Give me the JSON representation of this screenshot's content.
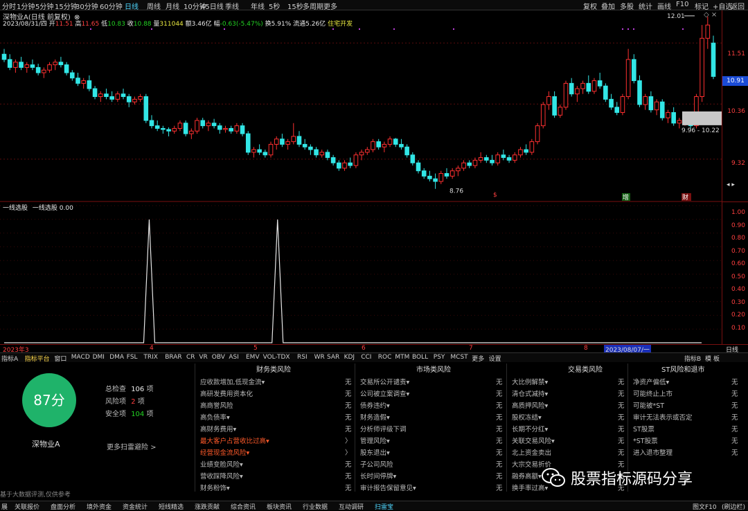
{
  "toolbar": {
    "timeframes": [
      "分时",
      "1分钟",
      "5分钟",
      "15分钟",
      "30分钟",
      "60分钟",
      "日线",
      "周线",
      "月线",
      "10分钟",
      "45日线",
      "季线",
      "年线",
      "5秒",
      "15秒",
      "多周期",
      "更多"
    ],
    "active_timeframe": "日线",
    "right_buttons": [
      "复权",
      "叠加",
      "多股",
      "统计",
      "画线",
      "F10",
      "标记",
      "+自选",
      "返回"
    ]
  },
  "stock": {
    "title": "深物业A(日线 前复权)",
    "date": "2023/08/31/四",
    "open_label": "开",
    "open": "11.51",
    "high_label": "高",
    "high": "11.65",
    "low_label": "低",
    "low": "10.83",
    "close_label": "收",
    "close": "10.88",
    "volume_label": "量",
    "volume": "311044",
    "amount_label": "额",
    "amount": "3.46亿",
    "change_label": "幅",
    "change": "-0.63(-5.47%)",
    "turnover_label": "换",
    "turnover": "5.91%",
    "float_label": "流通",
    "float_cap": "5.26亿",
    "concept": "住宅开发"
  },
  "price_axis": {
    "ticks": [
      "11.51",
      "10.36",
      "9.32"
    ],
    "current": "10.91"
  },
  "indicator": {
    "name": "一线选股",
    "line_label": "一线选股",
    "value": "0.00",
    "ticks": [
      "1.00",
      "0.90",
      "0.80",
      "0.70",
      "0.60",
      "0.50",
      "0.40",
      "0.30",
      "0.20",
      "0.10"
    ]
  },
  "annotations": {
    "high_label": "12.01",
    "low_label": "8.76",
    "range_label": "9.96 - 10.22",
    "marker_s": "$",
    "marker_zhu": "增",
    "marker_cai": "财"
  },
  "xaxis": {
    "labels": [
      "2023年3",
      "4",
      "5",
      "6",
      "7",
      "8"
    ],
    "cursor_date": "2023/08/07/一",
    "right_label": "日线"
  },
  "tabs": [
    "指标A",
    "指标平台",
    "窗口",
    "MACD",
    "DMI",
    "DMA",
    "FSL",
    "TRIX",
    "BRAR",
    "CR",
    "VR",
    "OBV",
    "ASI",
    "EMV",
    "VOL-TDX",
    "RSI",
    "WR",
    "SAR",
    "KDJ",
    "CCI",
    "ROC",
    "MTM",
    "BOLL",
    "PSY",
    "MCST",
    "更多",
    "设置"
  ],
  "active_tab": "指标平台",
  "tabs_right": [
    "指标B",
    "模",
    "板"
  ],
  "risk": {
    "score": "87分",
    "stock_name": "深物业A",
    "total_label": "总检查",
    "total": "106",
    "unit": "项",
    "risk_label": "风险项",
    "risk_count": "2",
    "safe_label": "安全项",
    "safe_count": "104",
    "more_label": "更多扫雷避险 >",
    "disclaimer": "基于大数据评测,仅供参考"
  },
  "columns": [
    {
      "title": "财务类风险",
      "items": [
        {
          "name": "应收款增加,低现金流▾",
          "value": "无",
          "hot": false
        },
        {
          "name": "高研发费用资本化",
          "value": "无",
          "hot": false
        },
        {
          "name": "高商誉风险",
          "value": "无",
          "hot": false
        },
        {
          "name": "高负债率▾",
          "value": "无",
          "hot": false
        },
        {
          "name": "高财务费用▾",
          "value": "无",
          "hot": false
        },
        {
          "name": "最大客户占营收比过高▾",
          "value": "〉",
          "hot": true
        },
        {
          "name": "经营现金流风险▾",
          "value": "〉",
          "hot": true
        },
        {
          "name": "业绩变脸风险▾",
          "value": "无",
          "hot": false
        },
        {
          "name": "营收踩降风险▾",
          "value": "无",
          "hot": false
        },
        {
          "name": "财务粉饰▾",
          "value": "无",
          "hot": false
        }
      ]
    },
    {
      "title": "市场类风险",
      "items": [
        {
          "name": "交易所公开谴责▾",
          "value": "无",
          "hot": false
        },
        {
          "name": "公司被立案调查▾",
          "value": "无",
          "hot": false
        },
        {
          "name": "债券违约▾",
          "value": "无",
          "hot": false
        },
        {
          "name": "财务造假▾",
          "value": "无",
          "hot": false
        },
        {
          "name": "分析师评级下调",
          "value": "无",
          "hot": false
        },
        {
          "name": "管理风险▾",
          "value": "无",
          "hot": false
        },
        {
          "name": "股东退出▾",
          "value": "无",
          "hot": false
        },
        {
          "name": "子公司风险",
          "value": "无",
          "hot": false
        },
        {
          "name": "长时间停牌▾",
          "value": "无",
          "hot": false
        },
        {
          "name": "审计报告保留意见▾",
          "value": "无",
          "hot": false
        }
      ]
    },
    {
      "title": "交易类风险",
      "items": [
        {
          "name": "大比例解禁▾",
          "value": "无",
          "hot": false
        },
        {
          "name": "清仓式减持▾",
          "value": "无",
          "hot": false
        },
        {
          "name": "高质押风险▾",
          "value": "无",
          "hot": false
        },
        {
          "name": "股权冻结▾",
          "value": "无",
          "hot": false
        },
        {
          "name": "长期不分红▾",
          "value": "无",
          "hot": false
        },
        {
          "name": "关联交易风险▾",
          "value": "无",
          "hot": false
        },
        {
          "name": "北上资金卖出",
          "value": "无",
          "hot": false
        },
        {
          "name": "大宗交易折价",
          "value": "无",
          "hot": false
        },
        {
          "name": "融券高额▾",
          "value": "无",
          "hot": false
        },
        {
          "name": "换手率过高▾",
          "value": "无",
          "hot": false
        }
      ]
    },
    {
      "title": "ST风险和退市",
      "items": [
        {
          "name": "净资产偏低▾",
          "value": "无",
          "hot": false
        },
        {
          "name": "可能终止上市",
          "value": "无",
          "hot": false
        },
        {
          "name": "可能被*ST",
          "value": "无",
          "hot": false
        },
        {
          "name": "审计无法表示或否定",
          "value": "无",
          "hot": false
        },
        {
          "name": "ST股票",
          "value": "无",
          "hot": false
        },
        {
          "name": "*ST股票",
          "value": "无",
          "hot": false
        },
        {
          "name": "进入退市整理",
          "value": "无",
          "hot": false
        }
      ]
    }
  ],
  "watermark": "股票指标源码分享",
  "statusbar": {
    "items": [
      "展",
      "关联报价",
      "盘面分析",
      "境外资金",
      "资金统计",
      "短线精选",
      "涨跌贡献",
      "综合资讯",
      "板块资讯",
      "行业数据",
      "互动调研",
      "扫雷宝"
    ],
    "active": "扫雷宝",
    "right": "图文F10",
    "right2": "(刷边栏)"
  },
  "colors": {
    "up": "#ff3030",
    "down": "#32e6e6",
    "grid": "#7a1010",
    "active": "#4fd7ff",
    "score_bg": "#1fb36a"
  },
  "chart_data": [
    {
      "type": "candlestick",
      "title": "深物业A(日线 前复权)",
      "ylim": [
        8.6,
        12.1
      ],
      "x_months": [
        "2023年3",
        "4",
        "5",
        "6",
        "7",
        "8"
      ],
      "ohlc": [
        [
          11.3,
          11.4,
          11.15,
          11.2
        ],
        [
          11.2,
          11.3,
          11.0,
          11.05
        ],
        [
          11.05,
          11.2,
          10.95,
          11.15
        ],
        [
          11.15,
          11.25,
          11.0,
          11.05
        ],
        [
          11.05,
          11.15,
          10.95,
          11.1
        ],
        [
          11.1,
          11.2,
          11.0,
          11.05
        ],
        [
          11.05,
          11.12,
          10.9,
          10.95
        ],
        [
          10.95,
          11.05,
          10.85,
          11.0
        ],
        [
          11.0,
          11.15,
          10.95,
          11.1
        ],
        [
          11.1,
          11.2,
          11.0,
          11.15
        ],
        [
          11.15,
          11.25,
          11.05,
          11.1
        ],
        [
          11.1,
          11.15,
          10.9,
          10.95
        ],
        [
          10.95,
          11.0,
          10.8,
          10.85
        ],
        [
          10.85,
          10.95,
          10.7,
          10.75
        ],
        [
          10.75,
          10.85,
          10.65,
          10.8
        ],
        [
          10.8,
          10.9,
          10.6,
          10.65
        ],
        [
          10.65,
          10.7,
          10.45,
          10.5
        ],
        [
          10.5,
          10.6,
          10.4,
          10.55
        ],
        [
          10.55,
          10.65,
          10.45,
          10.5
        ],
        [
          10.5,
          10.6,
          10.4,
          10.45
        ],
        [
          10.45,
          10.6,
          10.4,
          10.55
        ],
        [
          10.55,
          10.65,
          10.45,
          10.5
        ],
        [
          10.5,
          10.55,
          10.3,
          10.4
        ],
        [
          10.4,
          10.5,
          10.35,
          10.45
        ],
        [
          10.45,
          10.55,
          10.4,
          10.5
        ],
        [
          10.5,
          10.55,
          10.0,
          10.05
        ],
        [
          10.05,
          10.15,
          9.9,
          9.95
        ],
        [
          9.95,
          10.05,
          9.85,
          9.9
        ],
        [
          9.9,
          9.95,
          9.8,
          9.88
        ],
        [
          9.88,
          9.92,
          9.75,
          9.85
        ],
        [
          9.85,
          9.95,
          9.8,
          9.9
        ],
        [
          9.9,
          10.05,
          9.85,
          10.0
        ],
        [
          10.0,
          10.05,
          9.75,
          9.8
        ],
        [
          9.8,
          9.9,
          9.7,
          9.85
        ],
        [
          9.85,
          10.1,
          9.8,
          10.05
        ],
        [
          10.05,
          10.1,
          9.9,
          9.95
        ],
        [
          9.95,
          10.05,
          9.85,
          10.0
        ],
        [
          10.0,
          10.08,
          9.9,
          9.95
        ],
        [
          9.95,
          10.0,
          9.8,
          9.88
        ],
        [
          9.88,
          9.95,
          9.82,
          9.9
        ],
        [
          9.9,
          9.95,
          9.8,
          9.85
        ],
        [
          9.85,
          10.0,
          9.8,
          9.95
        ],
        [
          9.95,
          10.0,
          9.75,
          9.8
        ],
        [
          9.8,
          9.85,
          9.4,
          9.45
        ],
        [
          9.45,
          9.55,
          9.35,
          9.5
        ],
        [
          9.5,
          9.6,
          9.4,
          9.45
        ],
        [
          9.45,
          9.5,
          9.35,
          9.4
        ],
        [
          9.4,
          9.65,
          9.35,
          9.6
        ],
        [
          9.6,
          9.75,
          9.5,
          9.7
        ],
        [
          9.7,
          9.8,
          9.55,
          9.6
        ],
        [
          9.6,
          9.7,
          9.5,
          9.65
        ],
        [
          9.65,
          10.0,
          9.6,
          9.75
        ],
        [
          9.75,
          9.85,
          9.55,
          9.6
        ],
        [
          9.6,
          9.7,
          9.5,
          9.55
        ],
        [
          9.55,
          9.6,
          9.4,
          9.5
        ],
        [
          9.5,
          9.55,
          9.35,
          9.4
        ],
        [
          9.4,
          9.5,
          9.35,
          9.45
        ],
        [
          9.45,
          9.5,
          9.3,
          9.35
        ],
        [
          9.35,
          9.4,
          9.2,
          9.25
        ],
        [
          9.25,
          9.3,
          9.1,
          9.15
        ],
        [
          9.15,
          9.3,
          9.1,
          9.25
        ],
        [
          9.25,
          9.35,
          9.15,
          9.2
        ],
        [
          9.2,
          9.45,
          9.15,
          9.4
        ],
        [
          9.4,
          9.5,
          9.3,
          9.45
        ],
        [
          9.45,
          9.55,
          9.4,
          9.5
        ],
        [
          9.5,
          9.7,
          9.45,
          9.65
        ],
        [
          9.65,
          9.7,
          9.5,
          9.55
        ],
        [
          9.55,
          9.65,
          9.45,
          9.6
        ],
        [
          9.6,
          9.75,
          9.55,
          9.7
        ],
        [
          9.7,
          9.72,
          9.55,
          9.6
        ],
        [
          9.6,
          9.7,
          9.5,
          9.55
        ],
        [
          9.55,
          9.6,
          9.35,
          9.4
        ],
        [
          9.4,
          9.45,
          9.2,
          9.25
        ],
        [
          9.25,
          9.3,
          9.05,
          9.1
        ],
        [
          9.1,
          9.15,
          8.95,
          9.0
        ],
        [
          9.0,
          9.1,
          8.9,
          8.95
        ],
        [
          8.95,
          9.05,
          8.76,
          8.9
        ],
        [
          8.9,
          9.1,
          8.85,
          9.05
        ],
        [
          9.05,
          9.15,
          8.95,
          9.0
        ],
        [
          9.0,
          9.15,
          8.95,
          9.1
        ],
        [
          9.1,
          9.2,
          9.0,
          9.15
        ],
        [
          9.15,
          9.3,
          9.1,
          9.25
        ],
        [
          9.25,
          9.3,
          9.15,
          9.2
        ],
        [
          9.2,
          9.35,
          9.15,
          9.3
        ],
        [
          9.3,
          9.45,
          9.25,
          9.35
        ],
        [
          9.35,
          9.4,
          9.25,
          9.3
        ],
        [
          9.3,
          9.4,
          9.2,
          9.25
        ],
        [
          9.25,
          9.45,
          9.2,
          9.4
        ],
        [
          9.4,
          9.5,
          9.3,
          9.35
        ],
        [
          9.35,
          9.4,
          9.25,
          9.3
        ],
        [
          9.3,
          9.45,
          9.25,
          9.4
        ],
        [
          9.4,
          9.55,
          9.35,
          9.5
        ],
        [
          9.5,
          9.6,
          9.4,
          9.45
        ],
        [
          9.45,
          9.7,
          9.4,
          9.65
        ],
        [
          9.65,
          10.0,
          9.6,
          9.95
        ],
        [
          9.95,
          10.4,
          9.9,
          10.35
        ],
        [
          10.35,
          10.6,
          10.25,
          10.5
        ],
        [
          10.5,
          10.6,
          10.1,
          10.15
        ],
        [
          10.15,
          10.35,
          10.1,
          10.3
        ],
        [
          10.3,
          10.8,
          10.25,
          10.75
        ],
        [
          10.75,
          10.85,
          10.5,
          10.55
        ],
        [
          10.55,
          10.7,
          10.4,
          10.65
        ],
        [
          10.65,
          10.8,
          10.55,
          10.75
        ],
        [
          10.75,
          10.9,
          10.55,
          10.6
        ],
        [
          10.6,
          10.85,
          10.55,
          10.8
        ],
        [
          10.8,
          10.95,
          10.65,
          10.7
        ],
        [
          10.7,
          10.75,
          10.4,
          10.45
        ],
        [
          10.45,
          10.55,
          10.25,
          10.3
        ],
        [
          10.3,
          10.4,
          10.15,
          10.2
        ],
        [
          10.2,
          10.55,
          10.15,
          10.5
        ],
        [
          10.5,
          11.4,
          10.45,
          11.2
        ],
        [
          11.2,
          11.3,
          10.75,
          10.8
        ],
        [
          10.8,
          10.9,
          10.3,
          10.35
        ],
        [
          10.35,
          10.55,
          10.25,
          10.5
        ],
        [
          10.5,
          10.6,
          10.2,
          10.25
        ],
        [
          10.25,
          10.45,
          10.15,
          10.4
        ],
        [
          10.4,
          10.45,
          10.05,
          10.1
        ],
        [
          10.1,
          10.25,
          10.0,
          10.2
        ],
        [
          10.2,
          10.3,
          9.95,
          10.0
        ],
        [
          10.0,
          10.1,
          9.9,
          10.05
        ],
        [
          10.05,
          10.2,
          9.95,
          10.15
        ],
        [
          10.15,
          10.2,
          9.9,
          9.95
        ],
        [
          9.95,
          10.55,
          9.9,
          10.5
        ],
        [
          10.5,
          11.85,
          10.4,
          11.6
        ],
        [
          11.6,
          12.01,
          11.4,
          11.85
        ],
        [
          11.51,
          11.65,
          10.83,
          10.88
        ]
      ]
    },
    {
      "type": "line",
      "name": "一线选股",
      "ylim": [
        0,
        1
      ],
      "signal_indices": [
        26,
        49
      ],
      "points_count": 129
    }
  ]
}
